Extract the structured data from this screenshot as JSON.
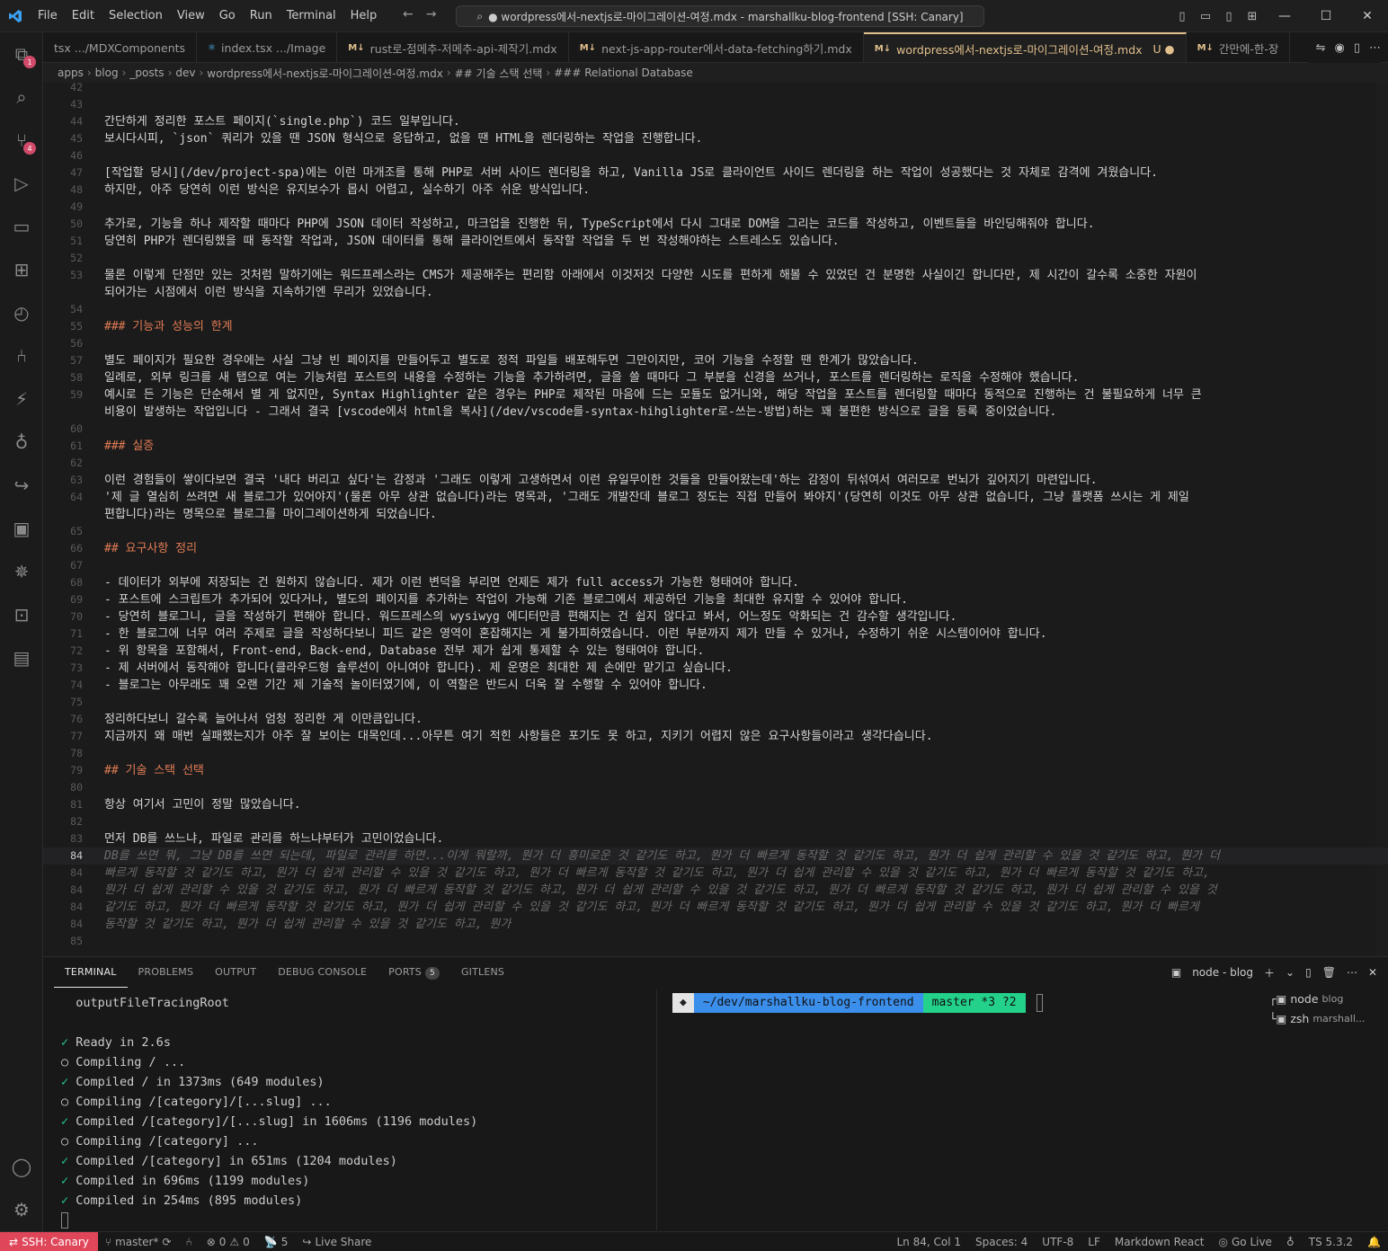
{
  "titlebar": {
    "logo": "vscode-logo",
    "menu": [
      "File",
      "Edit",
      "Selection",
      "View",
      "Go",
      "Run",
      "Terminal",
      "Help"
    ],
    "command_center": "● wordpress에서-nextjs로-마이그레이션-여정.mdx - marshallku-blog-frontend [SSH: Canary]"
  },
  "activity": {
    "items": [
      {
        "name": "explorer-icon",
        "glyph": "⧉",
        "badge": "1"
      },
      {
        "name": "search-icon",
        "glyph": "⌕",
        "badge": ""
      },
      {
        "name": "source-control-icon",
        "glyph": "⑂",
        "badge": "4"
      },
      {
        "name": "run-debug-icon",
        "glyph": "▷",
        "badge": ""
      },
      {
        "name": "remote-explorer-icon",
        "glyph": "▭",
        "badge": ""
      },
      {
        "name": "extensions-icon",
        "glyph": "⊞",
        "badge": ""
      },
      {
        "name": "timeline-icon",
        "glyph": "◴",
        "badge": ""
      },
      {
        "name": "git-graph-icon",
        "glyph": "⑃",
        "badge": ""
      },
      {
        "name": "thunder-client-icon",
        "glyph": "⚡",
        "badge": ""
      },
      {
        "name": "copilot-icon",
        "glyph": "♁",
        "badge": ""
      },
      {
        "name": "live-share-icon",
        "glyph": "↪",
        "badge": ""
      },
      {
        "name": "docker-icon",
        "glyph": "▣",
        "badge": ""
      },
      {
        "name": "kubernetes-icon",
        "glyph": "✵",
        "badge": ""
      },
      {
        "name": "database-icon",
        "glyph": "⊡",
        "badge": ""
      },
      {
        "name": "comments-icon",
        "glyph": "▤",
        "badge": ""
      }
    ],
    "bottom": [
      {
        "name": "accounts-icon",
        "glyph": "◯"
      },
      {
        "name": "manage-gear-icon",
        "glyph": "⚙"
      }
    ]
  },
  "tabs": [
    {
      "icon": "",
      "label": "tsx .../MDXComponents",
      "active": false,
      "dirty": ""
    },
    {
      "icon": "⚛",
      "label": "index.tsx .../Image",
      "active": false,
      "dirty": ""
    },
    {
      "icon": "M↓",
      "label": "rust로-점메추-저메추-api-제작기.mdx",
      "active": false,
      "dirty": ""
    },
    {
      "icon": "M↓",
      "label": "next-js-app-router에서-data-fetching하기.mdx",
      "active": false,
      "dirty": ""
    },
    {
      "icon": "M↓",
      "label": "wordpress에서-nextjs로-마이그레이션-여정.mdx",
      "active": true,
      "dirty": "U ●"
    },
    {
      "icon": "M↓",
      "label": "간만에-한-장",
      "active": false,
      "dirty": ""
    }
  ],
  "breadcrumb": [
    "apps",
    "blog",
    "_posts",
    "dev",
    "wordpress에서-nextjs로-마이그레이션-여정.mdx",
    "## 기술 스택 선택",
    "### Relational Database"
  ],
  "editor": {
    "lines": [
      {
        "n": "42",
        "t": "",
        "k": "p"
      },
      {
        "n": "43",
        "t": "",
        "k": "p"
      },
      {
        "n": "44",
        "t": "간단하게 정리한 포스트 페이지(`single.php`) 코드 일부입니다.",
        "k": "p"
      },
      {
        "n": "45",
        "t": "보시다시피, `json` 쿼리가 있을 땐 JSON 형식으로 응답하고, 없을 땐 HTML을 렌더링하는 작업을 진행합니다.",
        "k": "p"
      },
      {
        "n": "46",
        "t": "",
        "k": "p"
      },
      {
        "n": "47",
        "t": "[작업할 당시](/dev/project-spa)에는 이런 마개조를 통해 PHP로 서버 사이드 렌더링을 하고, Vanilla JS로 클라이언트 사이드 렌더링을 하는 작업이 성공했다는 것 자체로 감격에 겨웠습니다.",
        "k": "p"
      },
      {
        "n": "48",
        "t": "하지만, 아주 당연히 이런 방식은 유지보수가 몹시 어렵고, 실수하기 아주 쉬운 방식입니다.",
        "k": "p"
      },
      {
        "n": "49",
        "t": "",
        "k": "p"
      },
      {
        "n": "50",
        "t": "추가로, 기능을 하나 제작할 때마다 PHP에 JSON 데이터 작성하고, 마크업을 진행한 뒤, TypeScript에서 다시 그대로 DOM을 그리는 코드를 작성하고, 이벤트들을 바인딩해줘야 합니다.",
        "k": "p"
      },
      {
        "n": "51",
        "t": "당연히 PHP가 렌더링했을 때 동작할 작업과, JSON 데이터를 통해 클라이언트에서 동작할 작업을 두 번 작성해야하는 스트레스도 있습니다.",
        "k": "p"
      },
      {
        "n": "52",
        "t": "",
        "k": "p"
      },
      {
        "n": "53",
        "t": "물론 이렇게 단점만 있는 것처럼 말하기에는 워드프레스라는 CMS가 제공해주는 편리함 아래에서 이것저것 다양한 시도를 편하게 해볼 수 있었던 건 분명한 사실이긴 합니다만, 제 시간이 갈수록 소중한 자원이",
        "k": "p"
      },
      {
        "n": "",
        "t": "되어가는 시점에서 이런 방식을 지속하기엔 무리가 있었습니다.",
        "k": "p"
      },
      {
        "n": "54",
        "t": "",
        "k": "p"
      },
      {
        "n": "55",
        "t": "### 기능과 성능의 한계",
        "k": "h"
      },
      {
        "n": "56",
        "t": "",
        "k": "p"
      },
      {
        "n": "57",
        "t": "별도 페이지가 필요한 경우에는 사실 그냥 빈 페이지를 만들어두고 별도로 정적 파일들 배포해두면 그만이지만, 코어 기능을 수정할 땐 한계가 많았습니다.",
        "k": "p"
      },
      {
        "n": "58",
        "t": "일례로, 외부 링크를 새 탭으로 여는 기능처럼 포스트의 내용을 수정하는 기능을 추가하려면, 글을 쓸 때마다 그 부분을 신경을 쓰거나, 포스트를 렌더링하는 로직을 수정해야 했습니다.",
        "k": "p"
      },
      {
        "n": "59",
        "t": "예시로 든 기능은 단순해서 별 게 없지만, Syntax Highlighter 같은 경우는 PHP로 제작된 마음에 드는 모듈도 없거니와, 해당 작업을 포스트를 렌더링할 때마다 동적으로 진행하는 건 불필요하게 너무 큰",
        "k": "p"
      },
      {
        "n": "",
        "t": "비용이 발생하는 작업입니다 - 그래서 결국 [vscode에서 html을 복사](/dev/vscode를-syntax-hihglighter로-쓰는-방법)하는 꽤 불편한 방식으로 글을 등록 중이었습니다.",
        "k": "p"
      },
      {
        "n": "60",
        "t": "",
        "k": "p"
      },
      {
        "n": "61",
        "t": "### 실증",
        "k": "h"
      },
      {
        "n": "62",
        "t": "",
        "k": "p"
      },
      {
        "n": "63",
        "t": "이런 경험들이 쌓이다보면 결국 '내다 버리고 싶다'는 감정과 '그래도 이렇게 고생하면서 이런 유일무이한 것들을 만들어왔는데'하는 감정이 뒤섞여서 여러모로 번뇌가 깊어지기 마련입니다.",
        "k": "p"
      },
      {
        "n": "64",
        "t": "'제 글 열심히 쓰려면 새 블로그가 있어야지'(물론 아무 상관 없습니다)라는 명목과, '그래도 개발잔데 블로그 정도는 직접 만들어 봐야지'(당연히 이것도 아무 상관 없습니다, 그냥 플랫폼 쓰시는 게 제일",
        "k": "p"
      },
      {
        "n": "",
        "t": "편합니다)라는 명목으로 블로그를 마이그레이션하게 되었습니다.",
        "k": "p"
      },
      {
        "n": "65",
        "t": "",
        "k": "p"
      },
      {
        "n": "66",
        "t": "## 요구사항 정리",
        "k": "h"
      },
      {
        "n": "67",
        "t": "",
        "k": "p"
      },
      {
        "n": "68",
        "t": "- 데이터가 외부에 저장되는 건 원하지 않습니다. 제가 이런 변덕을 부리면 언제든 제가 full access가 가능한 형태여야 합니다.",
        "k": "li"
      },
      {
        "n": "69",
        "t": "- 포스트에 스크립트가 추가되어 있다거나, 별도의 페이지를 추가하는 작업이 가능해 기존 블로그에서 제공하던 기능을 최대한 유지할 수 있어야 합니다.",
        "k": "li"
      },
      {
        "n": "70",
        "t": "- 당연히 블로그니, 글을 작성하기 편해야 합니다. 워드프레스의 wysiwyg 에디터만큼 편해지는 건 쉽지 않다고 봐서, 어느정도 악화되는 건 감수할 생각입니다.",
        "k": "li"
      },
      {
        "n": "71",
        "t": "- 한 블로그에 너무 여러 주제로 글을 작성하다보니 피드 같은 영역이 혼잡해지는 게 불가피하였습니다. 이런 부분까지 제가 만들 수 있거나, 수정하기 쉬운 시스템이어야 합니다.",
        "k": "li"
      },
      {
        "n": "72",
        "t": "- 위 항목을 포함해서, Front-end, Back-end, Database 전부 제가 쉽게 통제할 수 있는 형태여야 합니다.",
        "k": "li"
      },
      {
        "n": "73",
        "t": "- 제 서버에서 동작해야 합니다(클라우드형 솔루션이 아니여야 합니다). 제 운명은 최대한 제 손에만 맡기고 싶습니다.",
        "k": "li"
      },
      {
        "n": "74",
        "t": "- 블로그는 아무래도 꽤 오랜 기간 제 기술적 놀이터였기에, 이 역할은 반드시 더욱 잘 수행할 수 있어야 합니다.",
        "k": "li"
      },
      {
        "n": "75",
        "t": "",
        "k": "p"
      },
      {
        "n": "76",
        "t": "정리하다보니 갈수록 늘어나서 엄청 정리한 게 이만큼입니다.",
        "k": "p"
      },
      {
        "n": "77",
        "t": "지금까지 왜 매번 실패했는지가 아주 잘 보이는 대목인데...아무튼 여기 적힌 사항들은 포기도 못 하고, 지키기 어렵지 않은 요구사항들이라고 생각다습니다.",
        "k": "p"
      },
      {
        "n": "78",
        "t": "",
        "k": "p"
      },
      {
        "n": "79",
        "t": "## 기술 스택 선택",
        "k": "h"
      },
      {
        "n": "80",
        "t": "",
        "k": "p"
      },
      {
        "n": "81",
        "t": "항상 여기서 고민이 정말 많았습니다.",
        "k": "p"
      },
      {
        "n": "82",
        "t": "",
        "k": "p"
      },
      {
        "n": "83",
        "t": "먼저 DB를 쓰느냐, 파일로 관리를 하느냐부터가 고민이었습니다.",
        "k": "p"
      },
      {
        "n": "84",
        "t": "DB를 쓰면 뭐, 그냥 DB를 쓰면 되는데, 파일로 관리를 하면...이게 뭐랄까, 뭔가 더 흥미로운 것 같기도 하고, 뭔가 더 빠르게 동작할 것 같기도 하고, 뭔가 더 쉽게 관리할 수 있을 것 같기도 하고, 뭔가 더",
        "k": "g",
        "cur": true
      },
      {
        "n": "84",
        "t": "빠르게 동작할 것 같기도 하고, 뭔가 더 쉽게 관리할 수 있을 것 같기도 하고, 뭔가 더 빠르게 동작할 것 같기도 하고, 뭔가 더 쉽게 관리할 수 있을 것 같기도 하고, 뭔가 더 빠르게 동작할 것 같기도 하고,",
        "k": "g"
      },
      {
        "n": "84",
        "t": "뭔가 더 쉽게 관리할 수 있을 것 같기도 하고, 뭔가 더 빠르게 동작할 것 같기도 하고, 뭔가 더 쉽게 관리할 수 있을 것 같기도 하고, 뭔가 더 빠르게 동작할 것 같기도 하고, 뭔가 더 쉽게 관리할 수 있을 것",
        "k": "g"
      },
      {
        "n": "84",
        "t": "같기도 하고, 뭔가 더 빠르게 동작할 것 같기도 하고, 뭔가 더 쉽게 관리할 수 있을 것 같기도 하고, 뭔가 더 빠르게 동작할 것 같기도 하고, 뭔가 더 쉽게 관리할 수 있을 것 같기도 하고, 뭔가 더 빠르게",
        "k": "g"
      },
      {
        "n": "84",
        "t": "동작할 것 같기도 하고, 뭔가 더 쉽게 관리할 수 있을 것 같기도 하고, 뭔가",
        "k": "g"
      },
      {
        "n": "85",
        "t": "",
        "k": "p"
      }
    ]
  },
  "panel": {
    "tabs": [
      {
        "label": "TERMINAL",
        "active": true,
        "badge": ""
      },
      {
        "label": "PROBLEMS",
        "active": false,
        "badge": ""
      },
      {
        "label": "OUTPUT",
        "active": false,
        "badge": ""
      },
      {
        "label": "DEBUG CONSOLE",
        "active": false,
        "badge": ""
      },
      {
        "label": "PORTS",
        "active": false,
        "badge": "5"
      },
      {
        "label": "GITLENS",
        "active": false,
        "badge": ""
      }
    ],
    "terminal_name": "node - blog",
    "left_lines": [
      {
        "p": "",
        "t": "  outputFileTracingRoot"
      },
      {
        "p": "",
        "t": ""
      },
      {
        "p": "✓",
        "t": "Ready in 2.6s"
      },
      {
        "p": "○",
        "t": "Compiling / ..."
      },
      {
        "p": "✓",
        "t": "Compiled / in 1373ms (649 modules)"
      },
      {
        "p": "○",
        "t": "Compiling /[category]/[...slug] ..."
      },
      {
        "p": "✓",
        "t": "Compiled /[category]/[...slug] in 1606ms (1196 modules)"
      },
      {
        "p": "○",
        "t": "Compiling /[category] ..."
      },
      {
        "p": "✓",
        "t": "Compiled /[category] in 651ms (1204 modules)"
      },
      {
        "p": "✓",
        "t": "Compiled in 696ms (1199 modules)"
      },
      {
        "p": "✓",
        "t": "Compiled in 254ms (895 modules)"
      }
    ],
    "prompt": {
      "os": "◆",
      "path": "~/dev/marshallku-blog-frontend",
      "git": "master *3 ?2"
    },
    "terminals": [
      {
        "label": "node",
        "sub": "blog"
      },
      {
        "label": "zsh",
        "sub": "marshall..."
      }
    ]
  },
  "status": {
    "remote": "SSH: Canary",
    "branch": "master*",
    "errors": "0",
    "warnings": "0",
    "ports": "5",
    "live_share": "Live Share",
    "position": "Ln 84, Col 1",
    "spaces": "Spaces: 4",
    "encoding": "UTF-8",
    "eol": "LF",
    "language": "Markdown React",
    "go_live": "Go Live",
    "ts": "TS 5.3.2"
  }
}
